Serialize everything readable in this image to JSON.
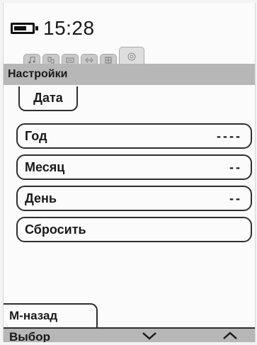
{
  "status": {
    "time": "15:28",
    "battery_level": 0.6
  },
  "tabs": [
    {
      "name": "tab-music",
      "icon": "music-icon",
      "active": false
    },
    {
      "name": "tab-folder",
      "icon": "folder-icon",
      "active": false
    },
    {
      "name": "tab-radio",
      "icon": "radio-icon",
      "active": false
    },
    {
      "name": "tab-link",
      "icon": "link-icon",
      "active": false
    },
    {
      "name": "tab-grid",
      "icon": "grid-icon",
      "active": false
    },
    {
      "name": "tab-settings",
      "icon": "settings-icon",
      "active": true
    }
  ],
  "header": {
    "title": "Настройки"
  },
  "subtab": {
    "label": "Дата"
  },
  "fields": {
    "year": {
      "label": "Год",
      "value": "----"
    },
    "month": {
      "label": "Месяц",
      "value": "--"
    },
    "day": {
      "label": "День",
      "value": "--"
    },
    "reset": {
      "label": "Сбросить"
    }
  },
  "footer": {
    "back_label": "M-назад",
    "select_label": "Выбор",
    "down_icon": "chevron-down-icon",
    "up_icon": "chevron-up-icon"
  }
}
